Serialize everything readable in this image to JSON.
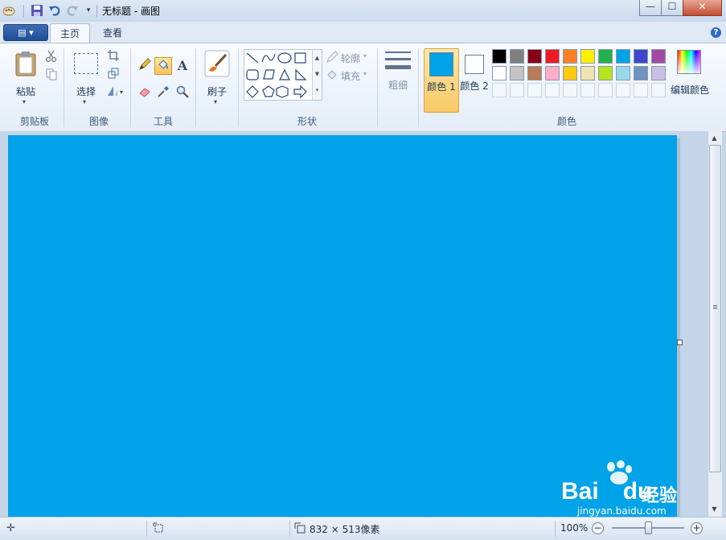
{
  "window": {
    "title": "无标题 - 画图",
    "min_glyph": "—",
    "max_glyph": "☐",
    "close_glyph": "✕"
  },
  "quick_access": {
    "app_icon": "paint-palette-icon",
    "save_icon": "save-icon",
    "undo_icon": "undo-icon",
    "redo_icon": "redo-icon",
    "customize_icon": "dropdown-icon"
  },
  "ribbon_tabs": {
    "file_menu_glyph": "▤ ▾",
    "tabs": [
      {
        "label": "主页",
        "selected": true
      },
      {
        "label": "查看",
        "selected": false
      }
    ],
    "help_glyph": "?"
  },
  "groups": {
    "clipboard": {
      "label": "剪贴板",
      "paste_label": "粘贴",
      "cut_icon": "scissors-icon",
      "copy_icon": "copy-icon"
    },
    "image": {
      "label": "图像",
      "select_label": "选择",
      "crop_icon": "crop-icon",
      "resize_icon": "resize-icon",
      "rotate_icon": "rotate-icon"
    },
    "tools": {
      "label": "工具",
      "text_glyph": "A",
      "active_tool": "fill-bucket"
    },
    "brushes": {
      "label": "刷子"
    },
    "shapes": {
      "label": "形状",
      "outline_label": "轮廓",
      "fill_label": "填充"
    },
    "size": {
      "label": "粗细"
    },
    "colors": {
      "label": "颜色",
      "color1_label": "颜色 1",
      "color2_label": "颜色 2",
      "edit_label": "编辑颜色",
      "color1": "#00a2e8",
      "color2": "#ffffff",
      "palette_row1": [
        "#000000",
        "#7f7f7f",
        "#880015",
        "#ed1c24",
        "#ff7f27",
        "#fff200",
        "#22b14c",
        "#00a2e8",
        "#3f48cc",
        "#a349a4"
      ],
      "palette_row2": [
        "#ffffff",
        "#c3c3c3",
        "#b97a57",
        "#ffaec9",
        "#ffc90e",
        "#efe4b0",
        "#b5e61d",
        "#99d9ea",
        "#7092be",
        "#c8bfe7"
      ]
    }
  },
  "canvas": {
    "fill_color": "#00a2e8"
  },
  "status": {
    "image_size": "832 × 513像素",
    "zoom": "100%",
    "zoom_minus": "−",
    "zoom_plus": "+",
    "zoom_level": 0.5
  },
  "watermark": {
    "brand": "Bai",
    "brand2": "du",
    "brand_cn": "经验",
    "url": "jingyan.baidu.com"
  }
}
